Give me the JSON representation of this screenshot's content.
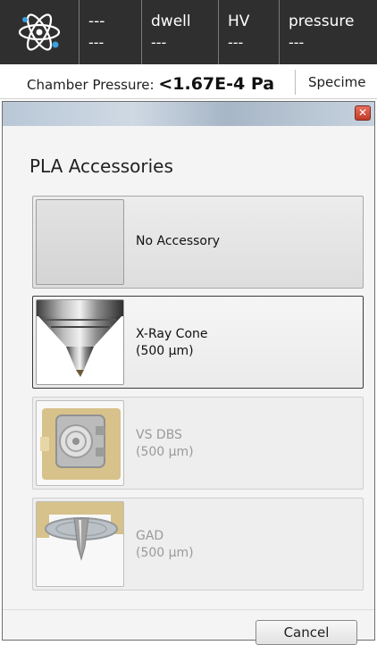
{
  "topbar": {
    "logo_icon": "atom-icon",
    "cells": [
      {
        "label": "---",
        "value": "---"
      },
      {
        "label": "dwell",
        "value": "---"
      },
      {
        "label": "HV",
        "value": "---"
      },
      {
        "label": "pressure",
        "value": "---"
      }
    ]
  },
  "infobar": {
    "chamber_label": "Chamber Pressure: ",
    "chamber_value": "<1.67E-4 Pa",
    "specimen_label": "Specime"
  },
  "dialog": {
    "heading": "PLA Accessories",
    "close_icon": "close-icon",
    "accessories": [
      {
        "name": "No Accessory",
        "size": "",
        "state": "normal"
      },
      {
        "name": "X-Ray Cone",
        "size": "(500 µm)",
        "state": "selected"
      },
      {
        "name": "VS DBS",
        "size": "(500 µm)",
        "state": "disabled"
      },
      {
        "name": "GAD",
        "size": "(500 µm)",
        "state": "disabled"
      }
    ],
    "cancel_label": "Cancel"
  }
}
